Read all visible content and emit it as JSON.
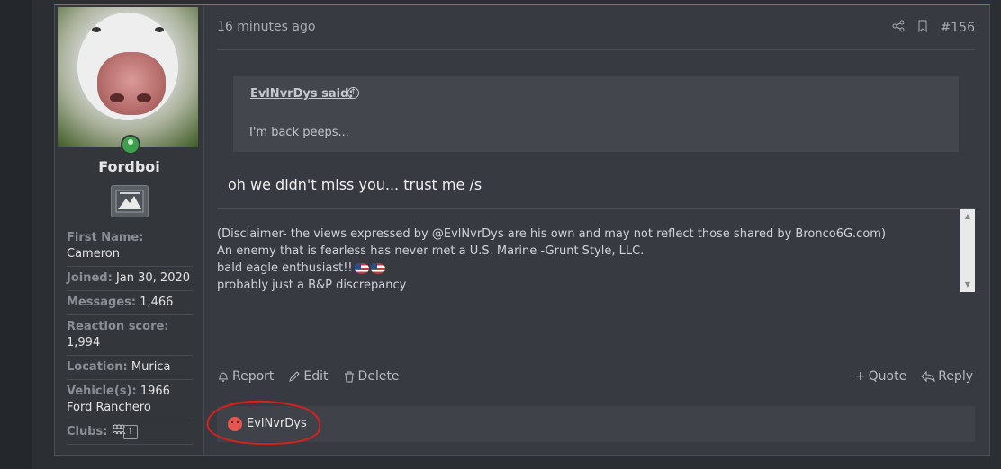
{
  "post": {
    "time": "16 minutes ago",
    "number": "#156",
    "share_icon": "share-icon",
    "bookmark_icon": "bookmark-icon"
  },
  "user": {
    "name": "Fordboi",
    "status": "online",
    "stats": [
      {
        "key": "First Name:",
        "value": "Cameron"
      },
      {
        "key": "Joined:",
        "value": "Jan 30, 2020"
      },
      {
        "key": "Messages:",
        "value": "1,466"
      },
      {
        "key": "Reaction score:",
        "value": "1,994"
      },
      {
        "key": "Location:",
        "value": "Murica"
      },
      {
        "key": "Vehicle(s):",
        "value": "1966 Ford Ranchero"
      },
      {
        "key": "Clubs:",
        "value": ""
      }
    ]
  },
  "quote": {
    "author": "EvlNvrDys said:",
    "text": "I'm back peeps..."
  },
  "message": "oh we didn't miss you... trust me /s",
  "signature": {
    "line1": "(Disclaimer- the views expressed by @EvlNvrDys are his own and may not reflect those shared by Bronco6G.com)",
    "line2": "An enemy that is fearless has never met a U.S. Marine -Grunt Style, LLC.",
    "line3": "bald eagle enthusiast!!",
    "line4": "probably just a B&P discrepancy"
  },
  "actions": {
    "report": "Report",
    "edit": "Edit",
    "delete": "Delete",
    "quote": "Quote",
    "reply": "Reply"
  },
  "reactions": {
    "user": "EvlNvrDys"
  },
  "colors": {
    "background": "#2b2e33",
    "panel": "#373b41",
    "accent": "#5a7fa8",
    "annotation": "#d4201f"
  }
}
